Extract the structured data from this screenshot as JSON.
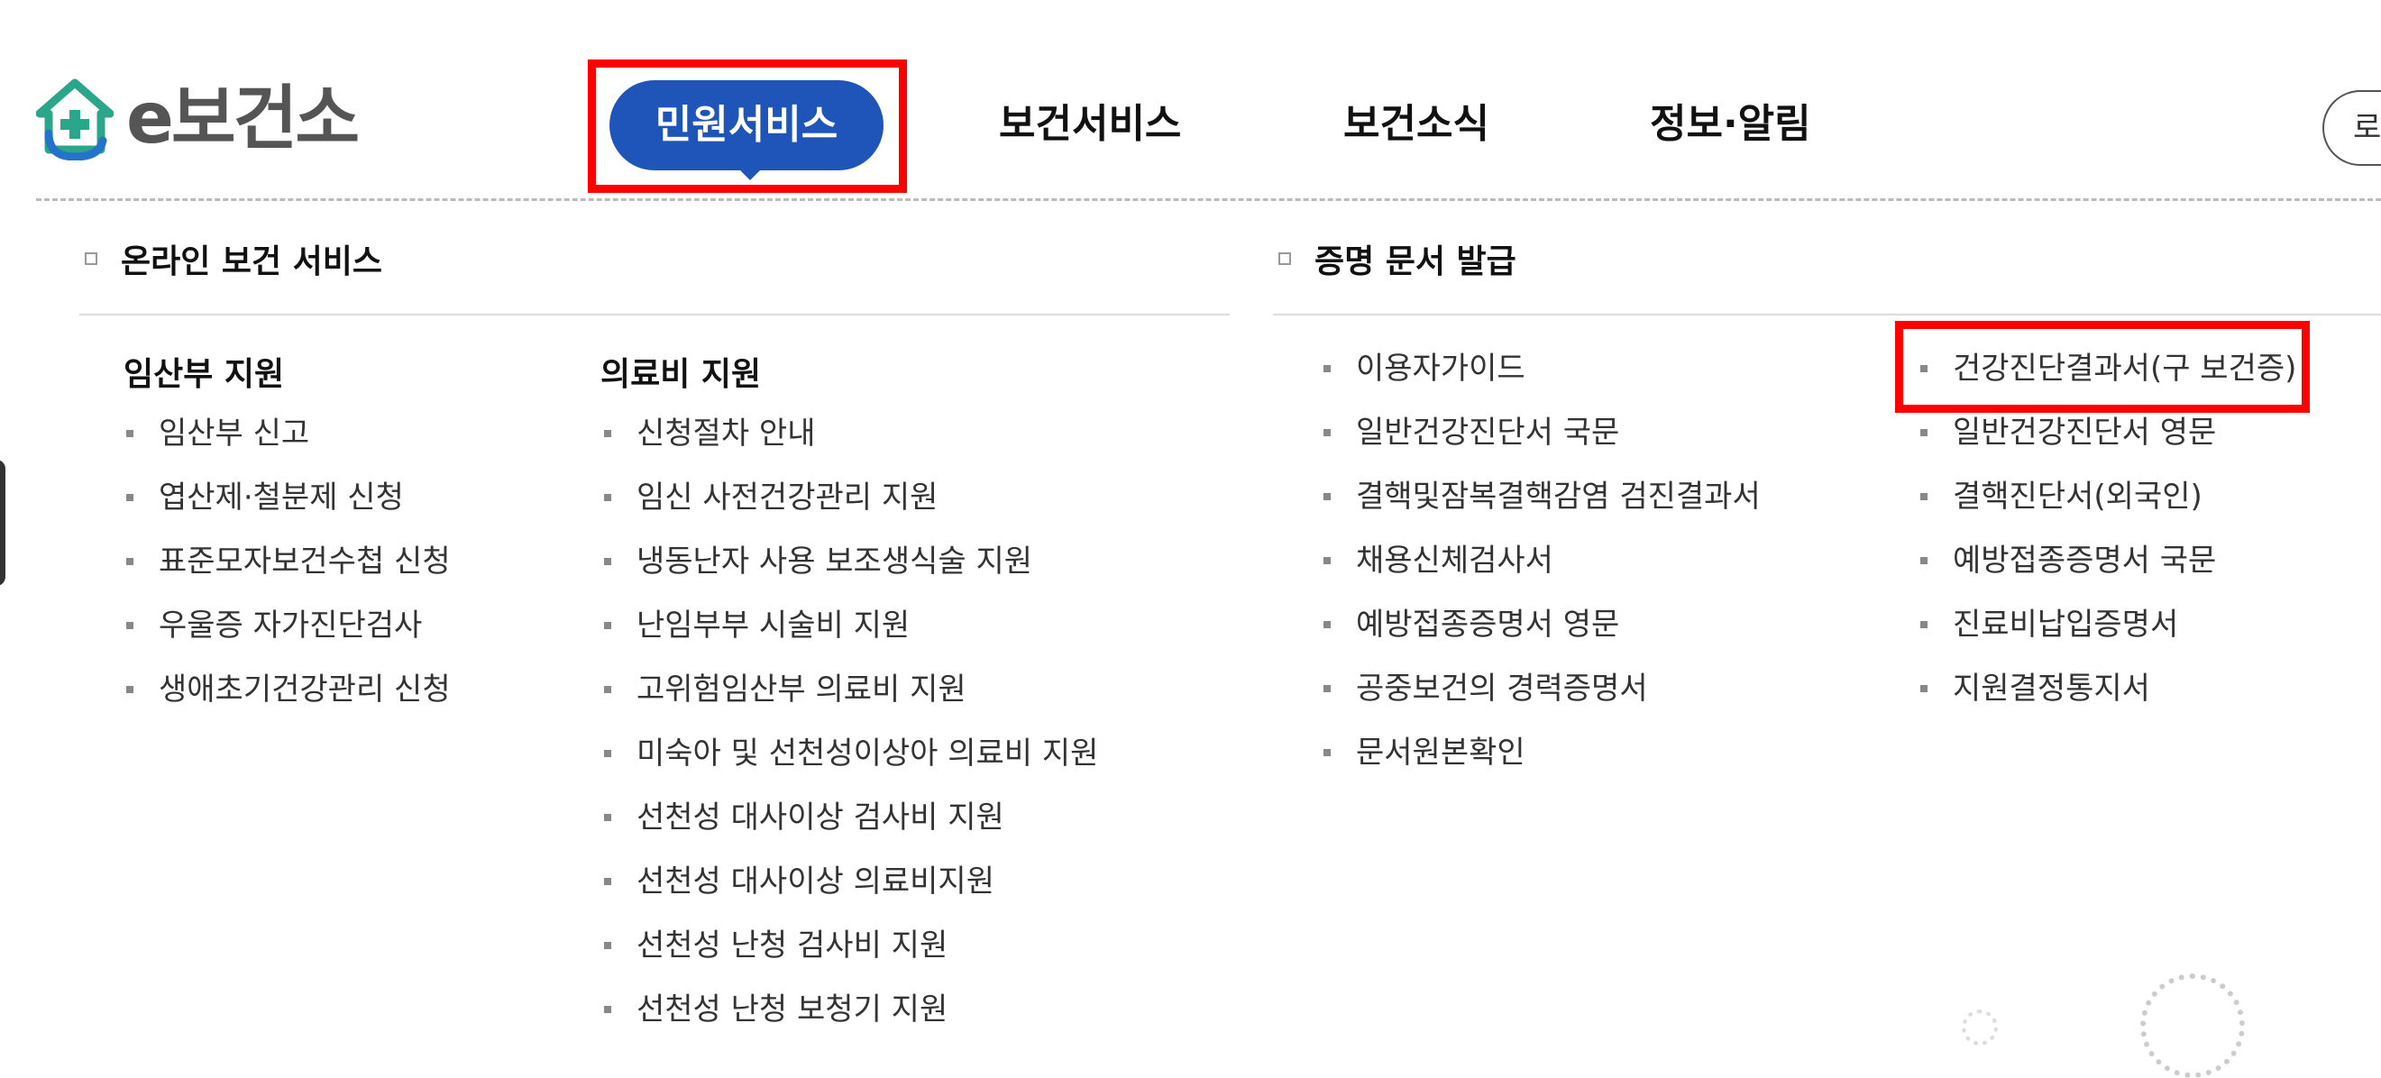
{
  "header": {
    "logo_text": "e보건소",
    "nav": [
      {
        "label": "민원서비스",
        "active": true
      },
      {
        "label": "보건서비스",
        "active": false
      },
      {
        "label": "보건소식",
        "active": false
      },
      {
        "label": "정보·알림",
        "active": false
      }
    ],
    "login_label": "로"
  },
  "online_service": {
    "title": "온라인 보건 서비스",
    "maternity": {
      "title": "임산부 지원",
      "items": [
        "임산부 신고",
        "엽산제·철분제 신청",
        "표준모자보건수첩 신청",
        "우울증 자가진단검사",
        "생애초기건강관리 신청"
      ]
    },
    "medical": {
      "title": "의료비 지원",
      "items": [
        "신청절차 안내",
        "임신 사전건강관리 지원",
        "냉동난자 사용 보조생식술 지원",
        "난임부부 시술비 지원",
        "고위험임산부 의료비 지원",
        "미숙아 및 선천성이상아 의료비 지원",
        "선천성 대사이상 검사비 지원",
        "선천성 대사이상 의료비지원",
        "선천성 난청 검사비 지원",
        "선천성 난청 보청기 지원"
      ]
    }
  },
  "certificate": {
    "title": "증명 문서 발급",
    "col1": [
      "이용자가이드",
      "일반건강진단서 국문",
      "결핵및잠복결핵감염 검진결과서",
      "채용신체검사서",
      "예방접종증명서 영문",
      "공중보건의 경력증명서",
      "문서원본확인"
    ],
    "col2": [
      "건강진단결과서(구 보건증)",
      "일반건강진단서 영문",
      "결핵진단서(외국인)",
      "예방접종증명서 국문",
      "진료비납입증명서",
      "지원결정통지서"
    ]
  },
  "colors": {
    "accent": "#1f55b8",
    "highlight": "#ff0000"
  }
}
